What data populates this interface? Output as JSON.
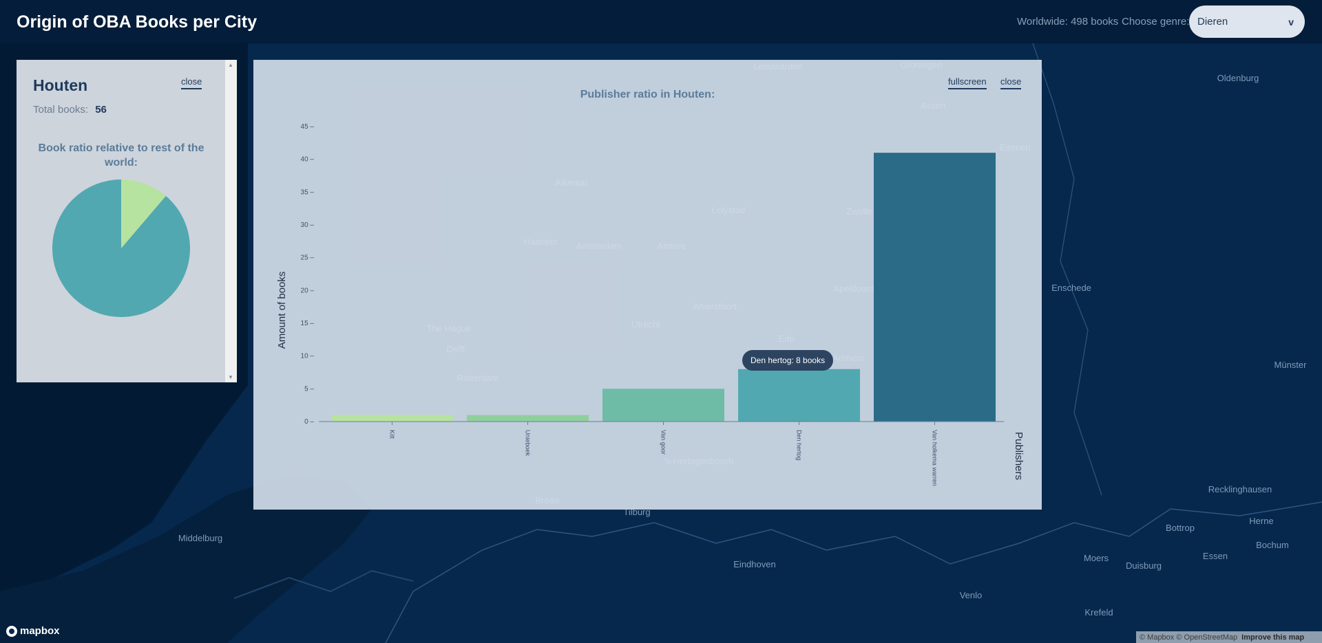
{
  "header": {
    "title": "Origin of OBA Books per City",
    "worldwide": "Worldwide: 498 books",
    "genre_label": "Choose genre:",
    "genre_value": "Dieren",
    "genre_chevron": "v"
  },
  "city_panel": {
    "city": "Houten",
    "close": "close",
    "total_label": "Total books:",
    "total_value": "56",
    "ratio_title": "Book ratio relative to rest of the world:",
    "pie": {
      "city_fraction": 0.1124,
      "colors": {
        "city": "#b7e3a0",
        "rest": "#52a8b0"
      }
    }
  },
  "chart_panel": {
    "title": "Publisher ratio in Houten:",
    "fullscreen": "fullscreen",
    "close": "close",
    "tooltip": "Den hertog: 8 books"
  },
  "chart_data": {
    "type": "bar",
    "title": "Publisher ratio in Houten:",
    "xlabel": "Publishers",
    "ylabel": "Amount of books",
    "categories": [
      "Kitt",
      "Unieboek",
      "Van goor",
      "Den hertog",
      "Van holkema warren"
    ],
    "values": [
      1,
      1,
      5,
      8,
      41
    ],
    "ylim": [
      0,
      45
    ],
    "yticks": [
      0,
      5,
      10,
      15,
      20,
      25,
      30,
      35,
      40,
      45
    ],
    "colors": [
      "#b7e3a0",
      "#8fcf9c",
      "#6fbca6",
      "#52a8b0",
      "#2b6b88"
    ]
  },
  "map": {
    "cities": [
      "Amsterdam",
      "Haarlem",
      "Almere",
      "Lelystad",
      "Alkmaar",
      "Utrecht",
      "Amersfoort",
      "The Hague",
      "Delft",
      "Rotterdam",
      "Ede",
      "Arnhem",
      "Apeldoorn",
      "Zwolle",
      "Assen",
      "Groningen",
      "Leeuwarden",
      "Emmen",
      "Enschede",
      "Oldenburg",
      "Münster",
      "'s-Hertogenbosch",
      "Breda",
      "Tilburg",
      "Middelburg",
      "Eindhoven",
      "Venlo",
      "Krefeld",
      "Moers",
      "Duisburg",
      "Essen",
      "Bottrop",
      "Bochum",
      "Herne",
      "Recklinghausen"
    ]
  },
  "footer": {
    "logo": "mapbox",
    "copyright": "© Mapbox © OpenStreetMap",
    "improve": "Improve this map"
  }
}
